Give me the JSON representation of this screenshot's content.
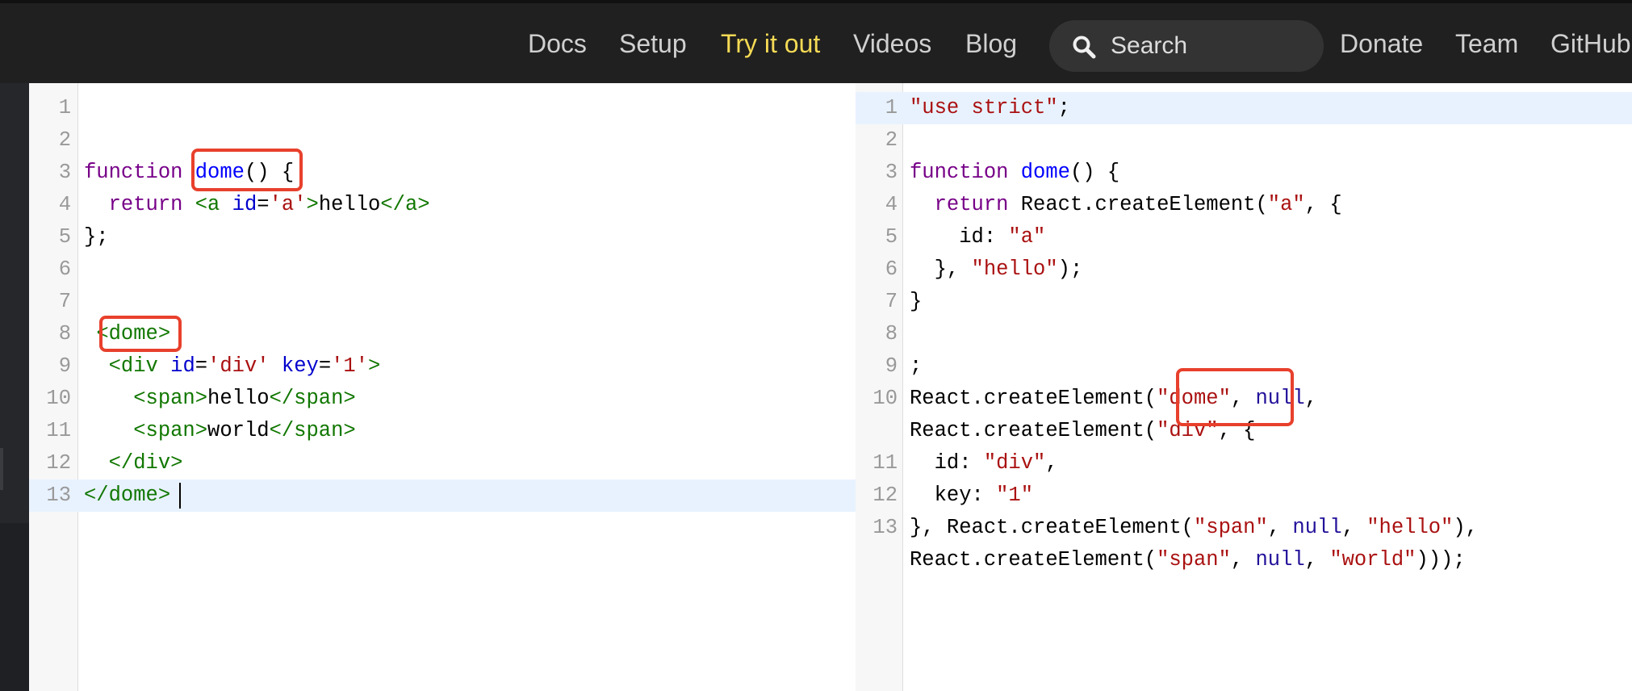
{
  "nav": {
    "docs": "Docs",
    "setup": "Setup",
    "try_it_out": "Try it out",
    "videos": "Videos",
    "blog": "Blog",
    "search_label": "Search",
    "donate": "Donate",
    "team": "Team",
    "github": "GitHub"
  },
  "colors": {
    "nav_bg": "#202020",
    "nav_active": "#f5da55",
    "annotation": "#e8402c"
  },
  "input_editor": {
    "lines": [
      {
        "num": "1",
        "tokens": []
      },
      {
        "num": "2",
        "tokens": []
      },
      {
        "num": "3",
        "tokens": [
          {
            "c": "kw",
            "t": "function"
          },
          {
            "c": "txt",
            "t": " "
          },
          {
            "c": "def",
            "t": "dome"
          },
          {
            "c": "txt",
            "t": "() {"
          }
        ]
      },
      {
        "num": "4",
        "tokens": [
          {
            "c": "txt",
            "t": "  "
          },
          {
            "c": "kw",
            "t": "return"
          },
          {
            "c": "txt",
            "t": " "
          },
          {
            "c": "tag",
            "t": "<a"
          },
          {
            "c": "txt",
            "t": " "
          },
          {
            "c": "attr",
            "t": "id"
          },
          {
            "c": "txt",
            "t": "="
          },
          {
            "c": "str",
            "t": "'a'"
          },
          {
            "c": "tag",
            "t": ">"
          },
          {
            "c": "txt",
            "t": "hello"
          },
          {
            "c": "tag",
            "t": "</a>"
          }
        ]
      },
      {
        "num": "5",
        "tokens": [
          {
            "c": "txt",
            "t": "};"
          }
        ]
      },
      {
        "num": "6",
        "tokens": []
      },
      {
        "num": "7",
        "tokens": []
      },
      {
        "num": "8",
        "tokens": [
          {
            "c": "txt",
            "t": " "
          },
          {
            "c": "tag",
            "t": "<dome>"
          }
        ]
      },
      {
        "num": "9",
        "tokens": [
          {
            "c": "txt",
            "t": "  "
          },
          {
            "c": "tag",
            "t": "<div"
          },
          {
            "c": "txt",
            "t": " "
          },
          {
            "c": "attr",
            "t": "id"
          },
          {
            "c": "txt",
            "t": "="
          },
          {
            "c": "str",
            "t": "'div'"
          },
          {
            "c": "txt",
            "t": " "
          },
          {
            "c": "attr",
            "t": "key"
          },
          {
            "c": "txt",
            "t": "="
          },
          {
            "c": "str",
            "t": "'1'"
          },
          {
            "c": "tag",
            "t": ">"
          }
        ]
      },
      {
        "num": "10",
        "tokens": [
          {
            "c": "txt",
            "t": "    "
          },
          {
            "c": "tag",
            "t": "<span>"
          },
          {
            "c": "txt",
            "t": "hello"
          },
          {
            "c": "tag",
            "t": "</span>"
          }
        ]
      },
      {
        "num": "11",
        "tokens": [
          {
            "c": "txt",
            "t": "    "
          },
          {
            "c": "tag",
            "t": "<span>"
          },
          {
            "c": "txt",
            "t": "world"
          },
          {
            "c": "tag",
            "t": "</span>"
          }
        ]
      },
      {
        "num": "12",
        "tokens": [
          {
            "c": "txt",
            "t": "  "
          },
          {
            "c": "tag",
            "t": "</div>"
          }
        ]
      },
      {
        "num": "13",
        "tokens": [
          {
            "c": "tag",
            "t": "</dome>"
          }
        ]
      }
    ]
  },
  "output_editor": {
    "lines": [
      {
        "num": "1",
        "tokens": [
          {
            "c": "str",
            "t": "\"use strict\""
          },
          {
            "c": "txt",
            "t": ";"
          }
        ]
      },
      {
        "num": "2",
        "tokens": []
      },
      {
        "num": "3",
        "tokens": [
          {
            "c": "kw",
            "t": "function"
          },
          {
            "c": "txt",
            "t": " "
          },
          {
            "c": "def",
            "t": "dome"
          },
          {
            "c": "txt",
            "t": "() {"
          }
        ]
      },
      {
        "num": "4",
        "tokens": [
          {
            "c": "txt",
            "t": "  "
          },
          {
            "c": "kw",
            "t": "return"
          },
          {
            "c": "txt",
            "t": " React.createElement("
          },
          {
            "c": "str",
            "t": "\"a\""
          },
          {
            "c": "txt",
            "t": ", {"
          }
        ]
      },
      {
        "num": "5",
        "tokens": [
          {
            "c": "txt",
            "t": "    id: "
          },
          {
            "c": "str",
            "t": "\"a\""
          }
        ]
      },
      {
        "num": "6",
        "tokens": [
          {
            "c": "txt",
            "t": "  }, "
          },
          {
            "c": "str",
            "t": "\"hello\""
          },
          {
            "c": "txt",
            "t": ");"
          }
        ]
      },
      {
        "num": "7",
        "tokens": [
          {
            "c": "txt",
            "t": "}"
          }
        ]
      },
      {
        "num": "8",
        "tokens": []
      },
      {
        "num": "9",
        "tokens": [
          {
            "c": "txt",
            "t": ";"
          }
        ]
      },
      {
        "num": "10",
        "tokens": [
          {
            "c": "txt",
            "t": "React.createElement("
          },
          {
            "c": "str",
            "t": "\"dome\""
          },
          {
            "c": "txt",
            "t": ", "
          },
          {
            "c": "null",
            "t": "null"
          },
          {
            "c": "txt",
            "t": ","
          }
        ]
      },
      {
        "num": "",
        "tokens": [
          {
            "c": "txt",
            "t": "React.createElement("
          },
          {
            "c": "str",
            "t": "\"div\""
          },
          {
            "c": "txt",
            "t": ", {"
          }
        ]
      },
      {
        "num": "11",
        "tokens": [
          {
            "c": "txt",
            "t": "  id: "
          },
          {
            "c": "str",
            "t": "\"div\""
          },
          {
            "c": "txt",
            "t": ","
          }
        ]
      },
      {
        "num": "12",
        "tokens": [
          {
            "c": "txt",
            "t": "  key: "
          },
          {
            "c": "str",
            "t": "\"1\""
          }
        ]
      },
      {
        "num": "13",
        "tokens": [
          {
            "c": "txt",
            "t": "}, React.createElement("
          },
          {
            "c": "str",
            "t": "\"span\""
          },
          {
            "c": "txt",
            "t": ", "
          },
          {
            "c": "null",
            "t": "null"
          },
          {
            "c": "txt",
            "t": ", "
          },
          {
            "c": "str",
            "t": "\"hello\""
          },
          {
            "c": "txt",
            "t": "),"
          }
        ]
      },
      {
        "num": "",
        "tokens": [
          {
            "c": "txt",
            "t": "React.createElement("
          },
          {
            "c": "str",
            "t": "\"span\""
          },
          {
            "c": "txt",
            "t": ", "
          },
          {
            "c": "null",
            "t": "null"
          },
          {
            "c": "txt",
            "t": ", "
          },
          {
            "c": "str",
            "t": "\"world\""
          },
          {
            "c": "txt",
            "t": ")));"
          }
        ]
      }
    ]
  }
}
